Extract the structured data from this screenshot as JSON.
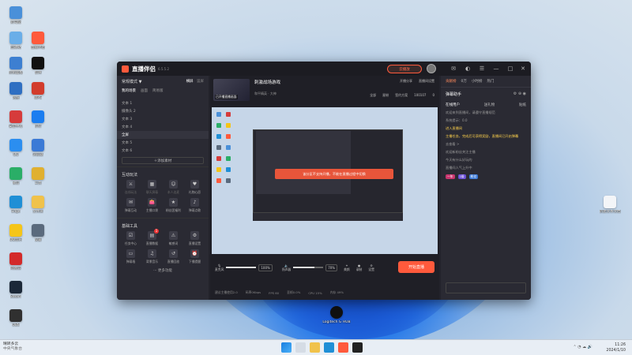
{
  "desktop": {
    "icons": [
      {
        "label": "此电脑",
        "color": "#4a90d9"
      },
      {
        "label": "回收站",
        "color": "#6aaee8"
      },
      {
        "label": "控制面板",
        "color": "#3d7fd1"
      },
      {
        "label": "网络",
        "color": "#2f6fc2"
      },
      {
        "label": "安全中心",
        "color": "#d63b3b"
      },
      {
        "label": "QQ",
        "color": "#2b8ef0"
      },
      {
        "label": "微信",
        "color": "#2aae67"
      },
      {
        "label": "Edge",
        "color": "#1f8fd6"
      },
      {
        "label": "QQ音乐",
        "color": "#f5c518"
      },
      {
        "label": "网易云",
        "color": "#d32a2a"
      },
      {
        "label": "Steam",
        "color": "#1b2838"
      },
      {
        "label": "OBS",
        "color": "#303030"
      },
      {
        "label": "直播伴侣",
        "color": "#ff5a3c"
      },
      {
        "label": "剪映",
        "color": "#111111"
      },
      {
        "label": "WPS",
        "color": "#d23c2c"
      },
      {
        "label": "钉钉",
        "color": "#1a7df0"
      },
      {
        "label": "浏览器",
        "color": "#3b7ad6"
      },
      {
        "label": "工具",
        "color": "#e0b030"
      },
      {
        "label": "文件夹",
        "color": "#f0c24b"
      },
      {
        "label": "设置",
        "color": "#5a6a7d"
      }
    ],
    "right_file_label": "新建文本文档",
    "center_icon_label": "Logitech G HUB"
  },
  "app": {
    "name": "直播伴侣",
    "version": "6.5.5.2",
    "cloud_button": "云播放",
    "left": {
      "mode_label": "常规模式",
      "mode_tabs": [
        "横屏",
        "竖屏"
      ],
      "scene_header": "我的场景",
      "sub_tabs": [
        "我的场景",
        "画面",
        "简易版"
      ],
      "scenes": [
        "文本 1",
        "摄像头 2",
        "文本 3",
        "文本 4",
        "全屏",
        "文本 5",
        "文本 6"
      ],
      "add_material": "添加素材",
      "interactive_title": "互动玩法",
      "interactive_tools": [
        {
          "label": "连线玩法",
          "dim": true
        },
        {
          "label": "聊天屏幕",
          "dim": true
        },
        {
          "label": "本人连麦",
          "dim": true
        },
        {
          "label": "礼物心愿",
          "dim": false
        },
        {
          "label": "弹幕互动",
          "dim": false
        },
        {
          "label": "主播口袋",
          "dim": false
        },
        {
          "label": "粉丝团福利",
          "dim": false
        },
        {
          "label": "弹幕点歌",
          "dim": false
        }
      ],
      "basic_title": "基础工具",
      "basic_tools": [
        {
          "label": "任务中心",
          "badge": ""
        },
        {
          "label": "直播数据",
          "badge": "1"
        },
        {
          "label": "敏感词",
          "badge": ""
        },
        {
          "label": "直播设置",
          "badge": ""
        },
        {
          "label": "弹幕墙",
          "badge": ""
        },
        {
          "label": "背景音乐",
          "badge": ""
        },
        {
          "label": "直播回放",
          "badge": ""
        },
        {
          "label": "下播提醒",
          "badge": ""
        }
      ],
      "more_label": "更多功能"
    },
    "center": {
      "stream_title": "刺激战场游戏",
      "thumb_label": "已开播直播画面",
      "stream_sub": "和平精英 · 大神",
      "top_stats": [
        "开播分享",
        "直播间设置"
      ],
      "stats": [
        "全部",
        "星粉",
        "签约方案",
        "100107",
        "0"
      ],
      "toast": "该分区不支持开播，不能在直播过程中切换",
      "mic_label": "麦克风",
      "mic_pct": "100%",
      "speaker_label": "扬声器",
      "speaker_pct": "70%",
      "mic_level": 1.0,
      "speaker_level": 0.7,
      "util_buttons": [
        "美颜",
        "录制",
        "设置"
      ],
      "start_button": "开始直播",
      "status": [
        "建议主播使用2.0",
        "码率0Kbps",
        "FPS 60",
        "丢帧0.0%",
        "CPU 15%",
        "内存 49%"
      ]
    },
    "right": {
      "tabs": [
        "贡献榜",
        "小时榜",
        "热门"
      ],
      "tab_value": "0万",
      "panel_title": "弹幕助手",
      "sub_tabs": [
        "在线用户",
        "送礼物",
        "贴纸"
      ],
      "chat": [
        {
          "text": "欢迎来到直播间，请遵守直播规范",
          "hl": false
        },
        {
          "text": "系统提示：0.0",
          "hl": false
        },
        {
          "text": "进入直播间",
          "hl": true
        },
        {
          "text": "主播任务，完成后可获得奖励，直播间已开启弹幕",
          "hl": true
        },
        {
          "text": "去查看 >",
          "hl": false
        },
        {
          "text": "欢迎新粉丝关注主播",
          "hl": false
        },
        {
          "text": "今天有什么好玩的",
          "hl": false
        },
        {
          "text": "直播间人气上升中",
          "hl": false
        }
      ],
      "pills": [
        "一年",
        "1级",
        "粉丝"
      ]
    }
  },
  "taskbar": {
    "weather_line1": "晴转多云",
    "weather_line2": "中央气象台",
    "time": "11:26",
    "date": "2024/1/10"
  }
}
